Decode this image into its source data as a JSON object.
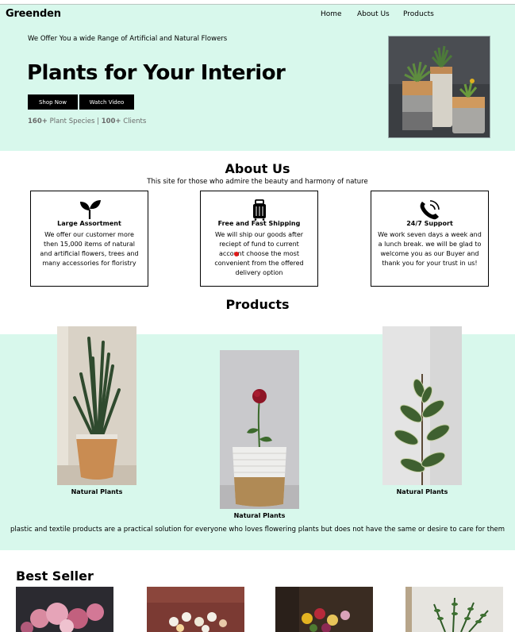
{
  "header": {
    "logo": "Greenden",
    "nav": [
      "Home",
      "About Us",
      "Products"
    ]
  },
  "hero": {
    "tagline": "We Offer You a wide Range of Artificial and Natural Flowers",
    "title": "Plants for Your Interior",
    "shop_button": "Shop Now",
    "video_button": "Watch Video",
    "stat1_value": "160+",
    "stat1_label": " Plant Species | ",
    "stat2_value": "100+",
    "stat2_label": " Clients"
  },
  "about": {
    "title": "About Us",
    "subtitle": "This site for those who admire the beauty and harmony of nature",
    "cards": [
      {
        "title": "Large Assortment",
        "icon": "sprout-icon",
        "text": "We offer our customer more then 15,000 items of natural and artificial flowers, trees and many accessories for floristry"
      },
      {
        "title": "Free and Fast Shipping",
        "icon": "luggage-icon",
        "text": "We will ship our goods after reciept of fund to current account choose the most convenient from the offered delivery option"
      },
      {
        "title": "24/7 Support",
        "icon": "phone-icon",
        "text": "We work seven days a week and a lunch break. we will be glad to welcome you as our Buyer and thank you for your trust in us!"
      }
    ]
  },
  "products": {
    "title": "Products",
    "items": [
      {
        "label": "Natural Plants",
        "image": "snake-plant-photo"
      },
      {
        "label": "Natural Plants",
        "image": "rose-basket-photo"
      },
      {
        "label": "Natural Plants",
        "image": "rubber-plant-photo"
      }
    ],
    "description": "plastic and textile products are a practical solution for everyone who loves flowering plants but does not have the same or desire to care for them"
  },
  "best_seller": {
    "title": "Best Seller",
    "items": [
      "pink-bouquet-photo",
      "white-flowers-photo",
      "mixed-bouquet-photo",
      "zz-plant-photo"
    ]
  },
  "colors": {
    "mint": "#d8f8ec",
    "black": "#000000",
    "marker": "#e01b1b"
  }
}
